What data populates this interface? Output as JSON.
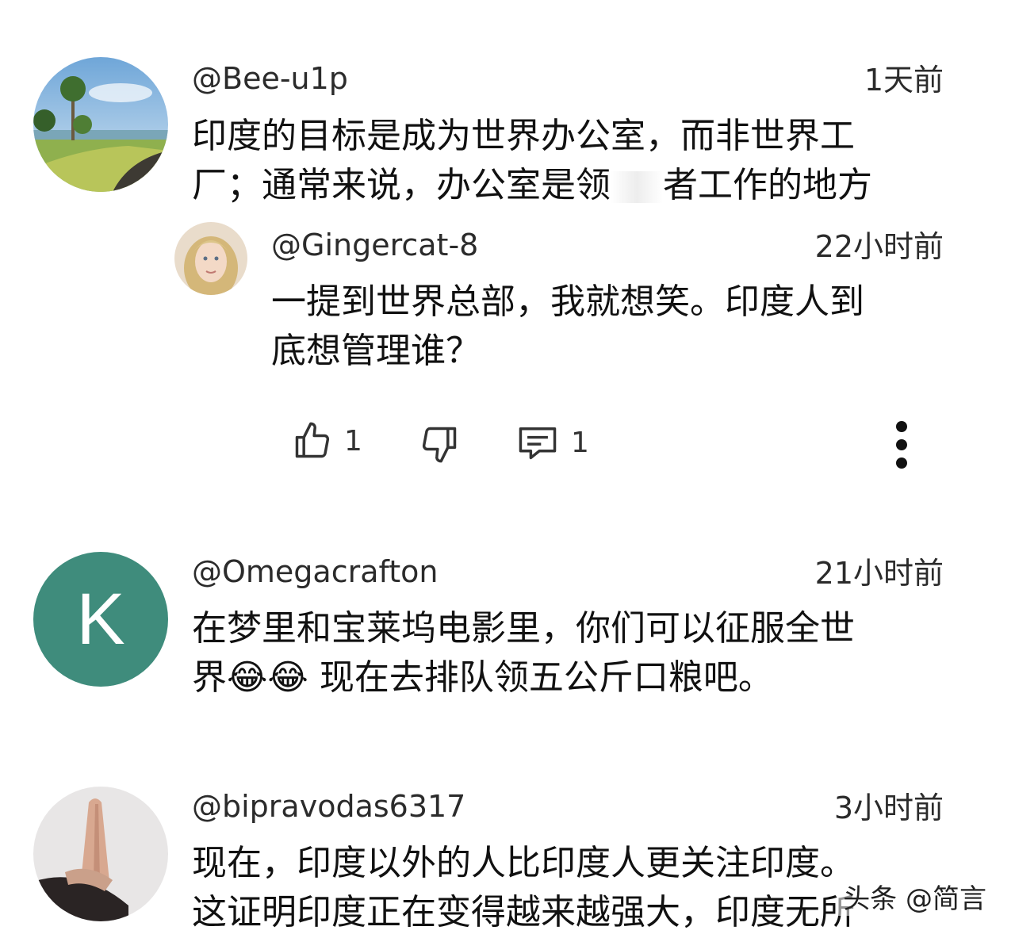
{
  "comments": [
    {
      "handle": "@Bee-u1p",
      "time": "1天前",
      "line1": "印度的目标是成为世界办公室，而非世界工",
      "line2_a": "厂；通常来说，办公室是",
      "line2_partial": "领",
      "line2_b": "者工作的地方",
      "avatar_icon": "beach-palm-avatar"
    },
    {
      "handle": "@Gingercat-8",
      "time": "22小时前",
      "line1": "一提到世界总部，我就想笑。印度人到",
      "line2": "底想管理谁？",
      "avatar_icon": "blonde-woman-avatar"
    },
    {
      "handle": "@Omegacrafton",
      "time": "21小时前",
      "line1": "在梦里和宝莱坞电影里，你们可以征服全世",
      "line2_a": "界",
      "line2_emoji": "😂😂",
      "line2_b": " 现在去排队领五公斤口粮吧。",
      "avatar_letter": "K",
      "avatar_color": "#3f8c7c"
    },
    {
      "handle": "@bipravodas6317",
      "time": "3小时前",
      "line1": "现在，印度以外的人比印度人更关注印度。",
      "line2": "这证明印度正在变得越来越强大，印度无所",
      "avatar_icon": "praying-hands-avatar"
    }
  ],
  "actions": {
    "like_count": "1",
    "reply_count": "1",
    "like_icon": "thumbs-up-icon",
    "dislike_icon": "thumbs-down-icon",
    "reply_icon": "comment-icon",
    "more_icon": "more-vertical-icon"
  },
  "watermark": "头条 @简言"
}
